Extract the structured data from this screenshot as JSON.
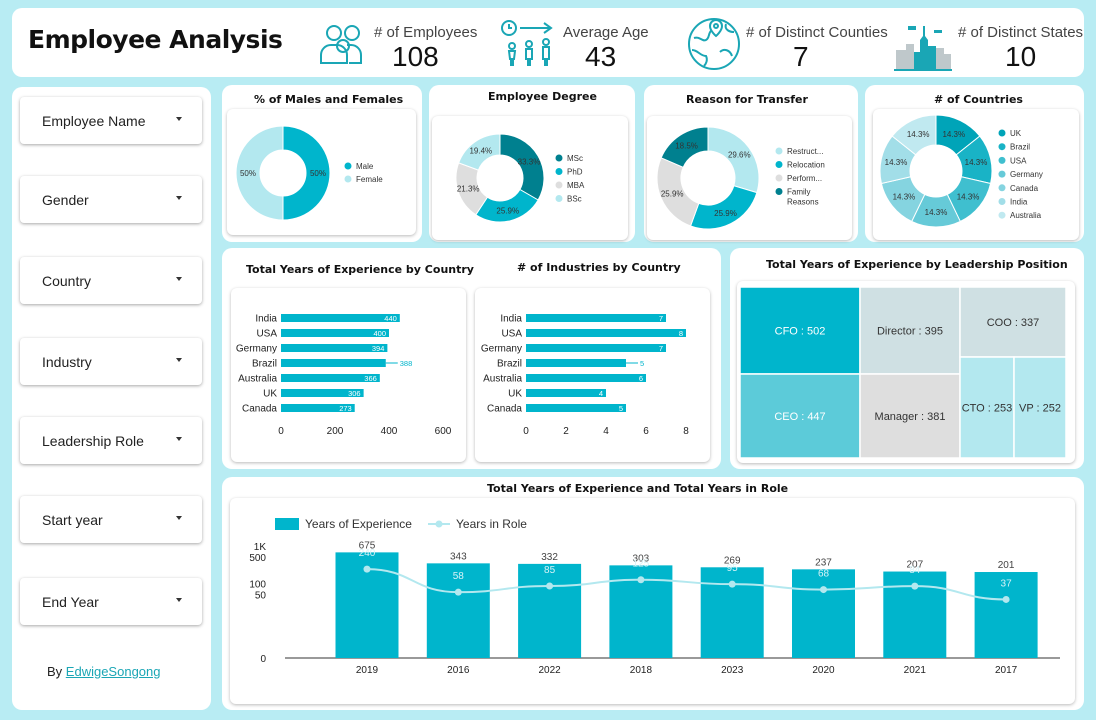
{
  "header": {
    "title": "Employee Analysis"
  },
  "kpis": [
    {
      "label": "# of Employees",
      "value": "108",
      "icon": "people-icon"
    },
    {
      "label": "Average Age",
      "value": "43",
      "icon": "timeline-people-icon"
    },
    {
      "label": "# of Distinct Counties",
      "value": "7",
      "icon": "globe-icon"
    },
    {
      "label": "# of Distinct States",
      "value": "10",
      "icon": "city-icon"
    }
  ],
  "filters": [
    {
      "label": "Employee Name"
    },
    {
      "label": "Gender"
    },
    {
      "label": "Country"
    },
    {
      "label": "Industry"
    },
    {
      "label": "Leadership Role"
    },
    {
      "label": "Start year"
    },
    {
      "label": "End Year"
    }
  ],
  "credit": {
    "prefix": "By",
    "link": "EdwigeSongong"
  },
  "colors": {
    "teal": "#00b5cc",
    "dark_teal": "#00808f",
    "light_teal": "#b3e8ef",
    "grey": "#dedede",
    "mid_teal": "#5ccbd9"
  },
  "chart_data": [
    {
      "id": "gender",
      "type": "pie",
      "title": "% of Males and Females",
      "labels": [
        "Male",
        "Female"
      ],
      "values": [
        50,
        50
      ],
      "value_labels": [
        "50%",
        "50%"
      ],
      "colors": [
        "#00b5cc",
        "#b3e8ef"
      ]
    },
    {
      "id": "degree",
      "type": "pie",
      "title": "Employee Degree",
      "labels": [
        "MSc",
        "PhD",
        "MBA",
        "BSc"
      ],
      "values": [
        33.3,
        25.9,
        21.3,
        19.4
      ],
      "value_labels": [
        "33.3%",
        "25.9%",
        "21.3%",
        "19.4%"
      ],
      "colors": [
        "#00808f",
        "#00b5cc",
        "#dedede",
        "#b3e8ef"
      ]
    },
    {
      "id": "transfer",
      "type": "pie",
      "title": "Reason for Transfer",
      "labels": [
        "Restruct...",
        "Relocation",
        "Perform...",
        "Family Reasons"
      ],
      "values": [
        29.6,
        25.9,
        25.9,
        18.5
      ],
      "value_labels": [
        "29.6%",
        "25.9%",
        "25.9%",
        "18.5%"
      ],
      "colors": [
        "#b3e8ef",
        "#00b5cc",
        "#dedede",
        "#00808f"
      ]
    },
    {
      "id": "countries",
      "type": "pie",
      "title": "# of Countries",
      "labels": [
        "UK",
        "Brazil",
        "USA",
        "Germany",
        "Canada",
        "India",
        "Australia"
      ],
      "values": [
        14.3,
        14.3,
        14.3,
        14.3,
        14.3,
        14.3,
        14.3
      ],
      "value_labels": [
        "14.3%",
        "14.3%",
        "14.3%",
        "14.3%",
        "14.3%",
        "14.3%",
        "14.3%"
      ],
      "colors": [
        "#00a4b8",
        "#19b3c6",
        "#3fbfcf",
        "#66cad8",
        "#85d4e0",
        "#a2dee8",
        "#c0e9f0"
      ]
    },
    {
      "id": "exp_country",
      "type": "bar",
      "orientation": "horizontal",
      "title": "Total Years of Experience by Country",
      "categories": [
        "India",
        "USA",
        "Germany",
        "Brazil",
        "Australia",
        "UK",
        "Canada"
      ],
      "values": [
        440,
        400,
        394,
        388,
        366,
        306,
        273
      ],
      "xlim": [
        0,
        600
      ],
      "xticks": [
        0,
        200,
        400,
        600
      ]
    },
    {
      "id": "ind_country",
      "type": "bar",
      "orientation": "horizontal",
      "title": "# of Industries by Country",
      "categories": [
        "India",
        "USA",
        "Germany",
        "Brazil",
        "Australia",
        "UK",
        "Canada"
      ],
      "values": [
        7,
        8,
        7,
        5,
        6,
        4,
        5
      ],
      "xlim": [
        0,
        8
      ],
      "xticks": [
        0,
        2,
        4,
        6,
        8
      ]
    },
    {
      "id": "leadership",
      "type": "treemap",
      "title": "Total Years of Experience by Leadership Position",
      "items": [
        {
          "label": "CFO : 502",
          "value": 502
        },
        {
          "label": "CEO : 447",
          "value": 447
        },
        {
          "label": "Director : 395",
          "value": 395
        },
        {
          "label": "Manager : 381",
          "value": 381
        },
        {
          "label": "COO : 337",
          "value": 337
        },
        {
          "label": "CTO : 253",
          "value": 253
        },
        {
          "label": "VP : 252",
          "value": 252
        }
      ]
    },
    {
      "id": "exp_role",
      "type": "bar",
      "title": "Total Years of Experience and Total Years in Role",
      "categories": [
        "2019",
        "2016",
        "2022",
        "2018",
        "2023",
        "2020",
        "2021",
        "2017"
      ],
      "series": [
        {
          "name": "Years of Experience",
          "type": "bar",
          "values": [
            675,
            343,
            332,
            303,
            269,
            237,
            207,
            201
          ]
        },
        {
          "name": "Years in Role",
          "type": "line",
          "values": [
            240,
            58,
            85,
            125,
            95,
            68,
            84,
            37
          ]
        }
      ],
      "yscale": "log",
      "yticks": [
        "1K",
        "500",
        "100",
        "50",
        "0"
      ]
    }
  ]
}
